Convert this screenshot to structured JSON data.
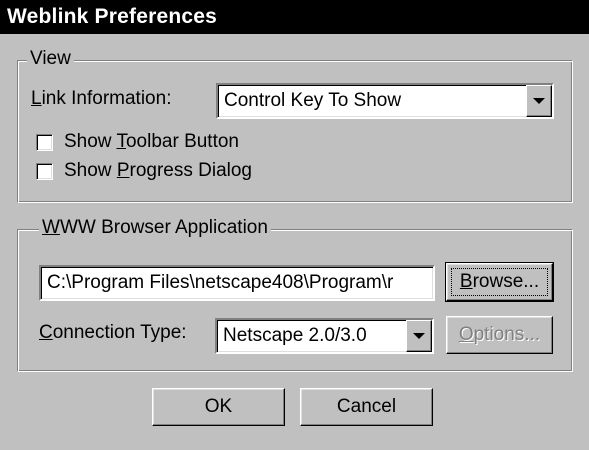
{
  "window": {
    "title": "Weblink Preferences"
  },
  "view_group": {
    "legend": "View",
    "link_info_label_pre": "",
    "link_info_label_ul": "L",
    "link_info_label_post": "ink Information:",
    "link_info_value": "Control Key To Show",
    "show_toolbar_pre": "Show ",
    "show_toolbar_ul": "T",
    "show_toolbar_post": "oolbar Button",
    "show_toolbar_checked": false,
    "show_progress_pre": "Show ",
    "show_progress_ul": "P",
    "show_progress_post": "rogress Dialog",
    "show_progress_checked": false
  },
  "browser_group": {
    "legend_ul": "W",
    "legend_post": "WW Browser Application",
    "path_value": "C:\\Program Files\\netscape408\\Program\\r",
    "browse_ul": "B",
    "browse_post": "rowse...",
    "conn_label_ul": "C",
    "conn_label_post": "onnection Type:",
    "conn_value": "Netscape 2.0/3.0",
    "options_ul": "O",
    "options_post": "ptions..."
  },
  "footer": {
    "ok_label": "OK",
    "cancel_label": "Cancel"
  }
}
